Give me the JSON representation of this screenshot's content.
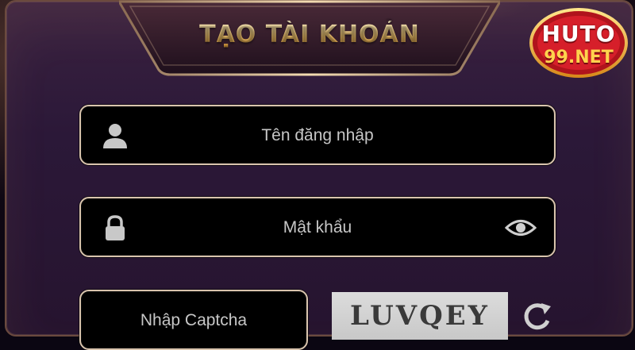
{
  "dialog": {
    "title": "TẠO TÀI KHOẢN"
  },
  "logo": {
    "text_main": "HUTO",
    "text_sub": "99.NET"
  },
  "form": {
    "username": {
      "placeholder": "Tên đăng nhập",
      "value": "",
      "icon": "user-icon"
    },
    "password": {
      "placeholder": "Mật khẩu",
      "value": "",
      "icon": "lock-icon",
      "toggle_icon": "eye-icon"
    },
    "captcha": {
      "placeholder": "Nhập Captcha",
      "value": "",
      "image_text": "LUVQEY",
      "refresh_icon": "refresh-icon"
    }
  },
  "colors": {
    "panel": "#2b1838",
    "field_border": "#d9c4ad",
    "title_gold": "#f2c46e",
    "logo_red": "#e0222e"
  }
}
